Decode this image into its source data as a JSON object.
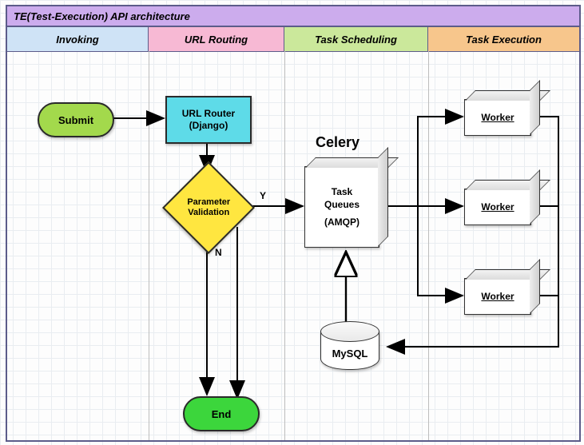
{
  "title": "TE(Test-Execution) API architecture",
  "lanes": {
    "invoking": "Invoking",
    "routing": "URL Routing",
    "scheduling": "Task Scheduling",
    "execution": "Task Execution"
  },
  "nodes": {
    "submit": "Submit",
    "url_router_l1": "URL Router",
    "url_router_l2": "(Django)",
    "param_validation_l1": "Parameter",
    "param_validation_l2": "Validation",
    "task_queues_l1": "Task",
    "task_queues_l2": "Queues",
    "task_queues_l3": "(AMQP)",
    "celery_label": "Celery",
    "mysql": "MySQL",
    "worker1": "Worker",
    "worker2": "Worker",
    "worker3": "Worker",
    "end": "End"
  },
  "edges": {
    "yes": "Y",
    "no": "N"
  },
  "chart_data": {
    "type": "flowchart",
    "title": "TE(Test-Execution) API architecture",
    "swimlanes": [
      "Invoking",
      "URL Routing",
      "Task Scheduling",
      "Task Execution"
    ],
    "nodes": [
      {
        "id": "submit",
        "label": "Submit",
        "shape": "terminator",
        "lane": "Invoking"
      },
      {
        "id": "router",
        "label": "URL Router (Django)",
        "shape": "process",
        "lane": "URL Routing"
      },
      {
        "id": "validate",
        "label": "Parameter Validation",
        "shape": "decision",
        "lane": "URL Routing"
      },
      {
        "id": "end",
        "label": "End",
        "shape": "terminator",
        "lane": "URL Routing"
      },
      {
        "id": "queue",
        "label": "Task Queues (AMQP)",
        "group": "Celery",
        "shape": "queue",
        "lane": "Task Scheduling"
      },
      {
        "id": "mysql",
        "label": "MySQL",
        "shape": "database",
        "lane": "Task Scheduling"
      },
      {
        "id": "w1",
        "label": "Worker",
        "shape": "process3d",
        "lane": "Task Execution"
      },
      {
        "id": "w2",
        "label": "Worker",
        "shape": "process3d",
        "lane": "Task Execution"
      },
      {
        "id": "w3",
        "label": "Worker",
        "shape": "process3d",
        "lane": "Task Execution"
      }
    ],
    "edges": [
      {
        "from": "submit",
        "to": "router"
      },
      {
        "from": "router",
        "to": "validate"
      },
      {
        "from": "validate",
        "to": "queue",
        "label": "Y"
      },
      {
        "from": "validate",
        "to": "end",
        "label": "N"
      },
      {
        "from": "validate",
        "to": "end"
      },
      {
        "from": "queue",
        "to": "w1"
      },
      {
        "from": "queue",
        "to": "w2"
      },
      {
        "from": "queue",
        "to": "w3"
      },
      {
        "from": "w1",
        "to": "mysql"
      },
      {
        "from": "w2",
        "to": "mysql"
      },
      {
        "from": "w3",
        "to": "mysql"
      },
      {
        "from": "mysql",
        "to": "queue",
        "style": "open-arrow"
      }
    ]
  }
}
